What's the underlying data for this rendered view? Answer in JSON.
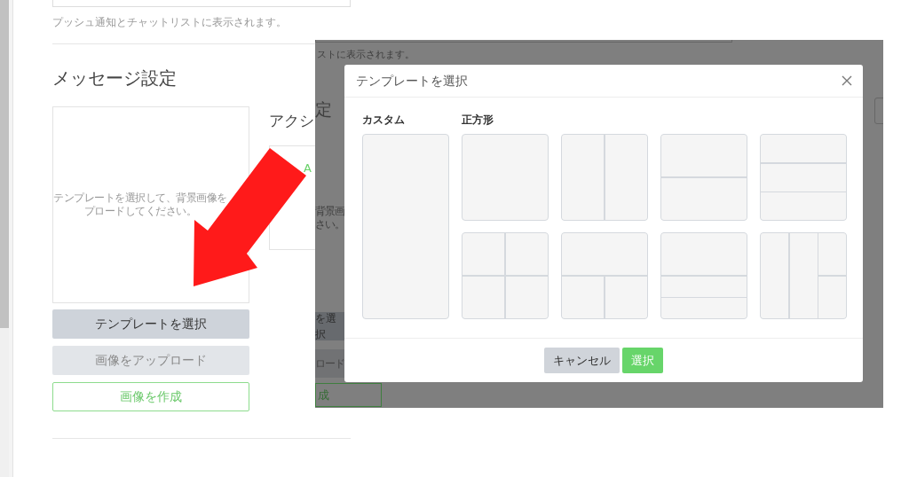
{
  "page": {
    "field_hint": "プッシュ通知とチャットリストに表示されます。",
    "section_title": "メッセージ設定",
    "preview_lines": [
      "テンプレートを選択して、背景画像を",
      "プロードしてください。"
    ],
    "buttons": [
      {
        "label": "テンプレートを選択",
        "kind": "secondary"
      },
      {
        "label": "画像をアップロード",
        "kind": "light"
      },
      {
        "label": "画像を作成",
        "kind": "outline"
      }
    ],
    "action_title": "アクシ",
    "action_preview_mark": "A"
  },
  "dimmed_page": {
    "field_hint": "ストに表示されます。",
    "title_fragment": "定",
    "preview_lines": [
      "背景画",
      "さい。"
    ],
    "buttons": [
      {
        "label": "を選択",
        "kind": "secondary"
      },
      {
        "label": "ロード",
        "kind": "light"
      },
      {
        "label": "成",
        "kind": "outline"
      }
    ]
  },
  "modal": {
    "title": "テンプレートを選択",
    "custom_label": "カスタム",
    "square_label": "正方形",
    "templates": [
      {
        "kind": "single"
      },
      {
        "kind": "halves"
      },
      {
        "kind": "rows"
      },
      {
        "kind": "thirds"
      },
      {
        "kind": "quarters"
      },
      {
        "kind": "topsplit"
      },
      {
        "kind": "bands"
      },
      {
        "kind": "columns"
      }
    ],
    "footer_buttons": [
      {
        "label": "キャンセル",
        "kind": "cancel"
      },
      {
        "label": "選択",
        "kind": "primary"
      }
    ]
  }
}
